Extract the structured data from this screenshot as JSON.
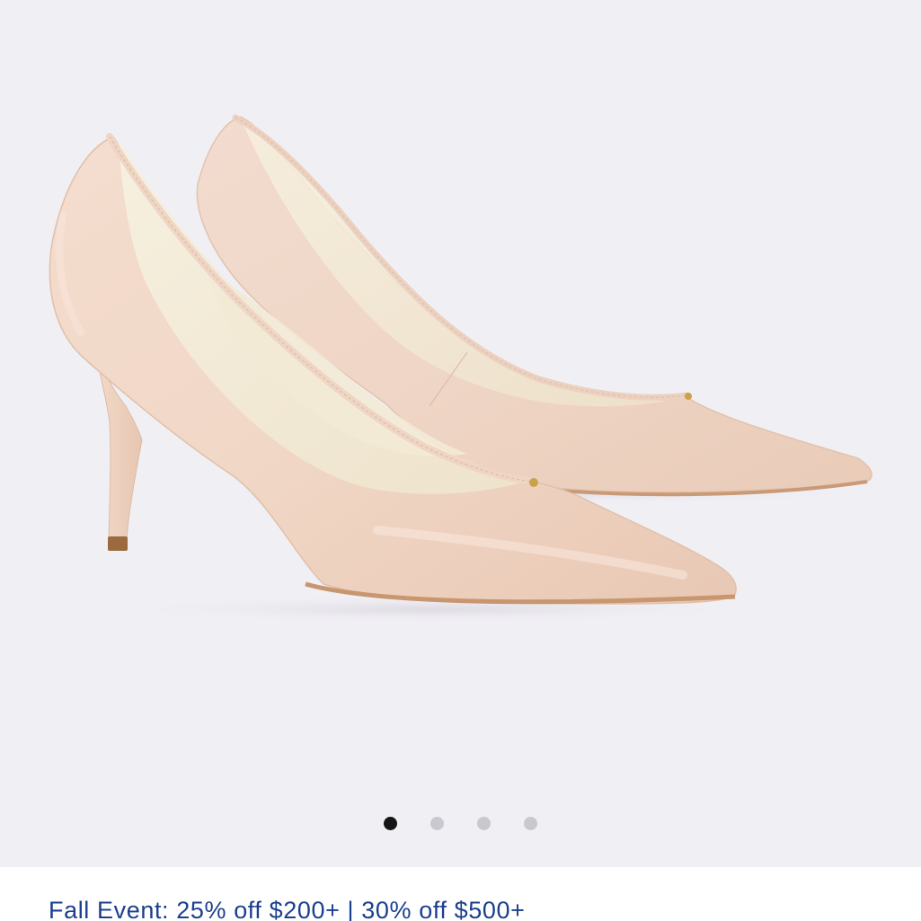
{
  "product_gallery": {
    "image_alt": "Light nude pointed-toe leather pumps with stiletto heel",
    "dots": [
      {
        "label": "Image 1",
        "active": true
      },
      {
        "label": "Image 2",
        "active": false
      },
      {
        "label": "Image 3",
        "active": false
      },
      {
        "label": "Image 4",
        "active": false
      }
    ]
  },
  "promo_banner": {
    "text": "Fall Event: 25% off $200+ | 30% off $500+"
  },
  "colors": {
    "background": "#f0eff4",
    "leather": "#f2d8c7",
    "lining": "#f5eddc",
    "promo_text": "#1b3f8f",
    "dot_active": "#151515",
    "dot_inactive": "#c9c8ce"
  }
}
